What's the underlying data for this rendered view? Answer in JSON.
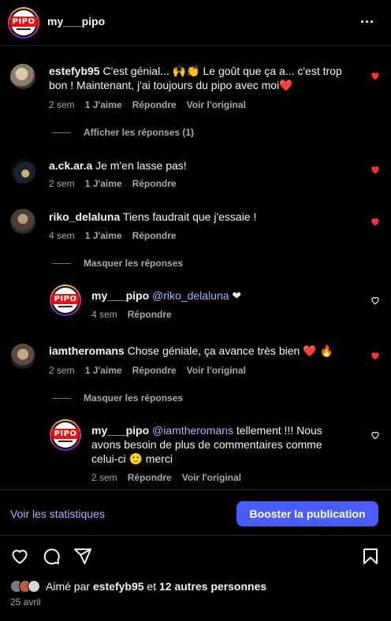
{
  "header": {
    "username": "my___pipo",
    "logo_text": "PIPO"
  },
  "comments": [
    {
      "username": "estefyb95",
      "text_line1": "C'est génial... 🙌👏 Le goût que ça a... c'est trop",
      "text_line2": "bon ! Maintenant, j'ai toujours du pipo avec moi❤️",
      "time": "2 sem",
      "likes": "1 J'aime",
      "reply": "Répondre",
      "original": "Voir l'original",
      "replies_toggle": "Afficher les réponses (1)"
    },
    {
      "username": "a.ck.ar.a",
      "text_line1": "Je m'en lasse pas!",
      "time": "2 sem",
      "likes": "1 J'aime",
      "reply": "Répondre"
    },
    {
      "username": "riko_delaluna",
      "text_line1": "Tiens faudrait que j'essaie !",
      "time": "4 sem",
      "likes": "1 J'aime",
      "reply": "Répondre",
      "replies_toggle": "Masquer les réponses",
      "reply_item": {
        "username": "my___pipo",
        "mention": "@riko_delaluna",
        "text": "❤",
        "time": "4 sem",
        "reply": "Répondre"
      }
    },
    {
      "username": "iamtheromans",
      "text_line1": "Chose géniale, ça avance très bien ❤️ 🔥",
      "time": "2 sem",
      "likes": "1 J'aime",
      "reply": "Répondre",
      "original": "Voir l'original",
      "replies_toggle": "Masquer les réponses",
      "reply_item": {
        "username": "my___pipo",
        "mention": "@iamtheromans",
        "text": "tellement !!! Nous",
        "text_line2": "avons besoin de plus de commentaires comme",
        "text_line3": "celui-ci 🙂 merci",
        "time": "2 sem",
        "reply": "Répondre",
        "original": "Voir l'original"
      }
    }
  ],
  "actions": {
    "stats_link": "Voir les statistiques",
    "boost_button": "Booster la publication"
  },
  "likes": {
    "prefix": "Aimé par",
    "user": "estefyb95",
    "middle": "et",
    "others": "12 autres personnes"
  },
  "date": "25 avril",
  "colors": {
    "accent": "#4a5df9",
    "link": "#a8b4ff",
    "heart": "#ff3040",
    "muted": "#a8a8a8"
  }
}
